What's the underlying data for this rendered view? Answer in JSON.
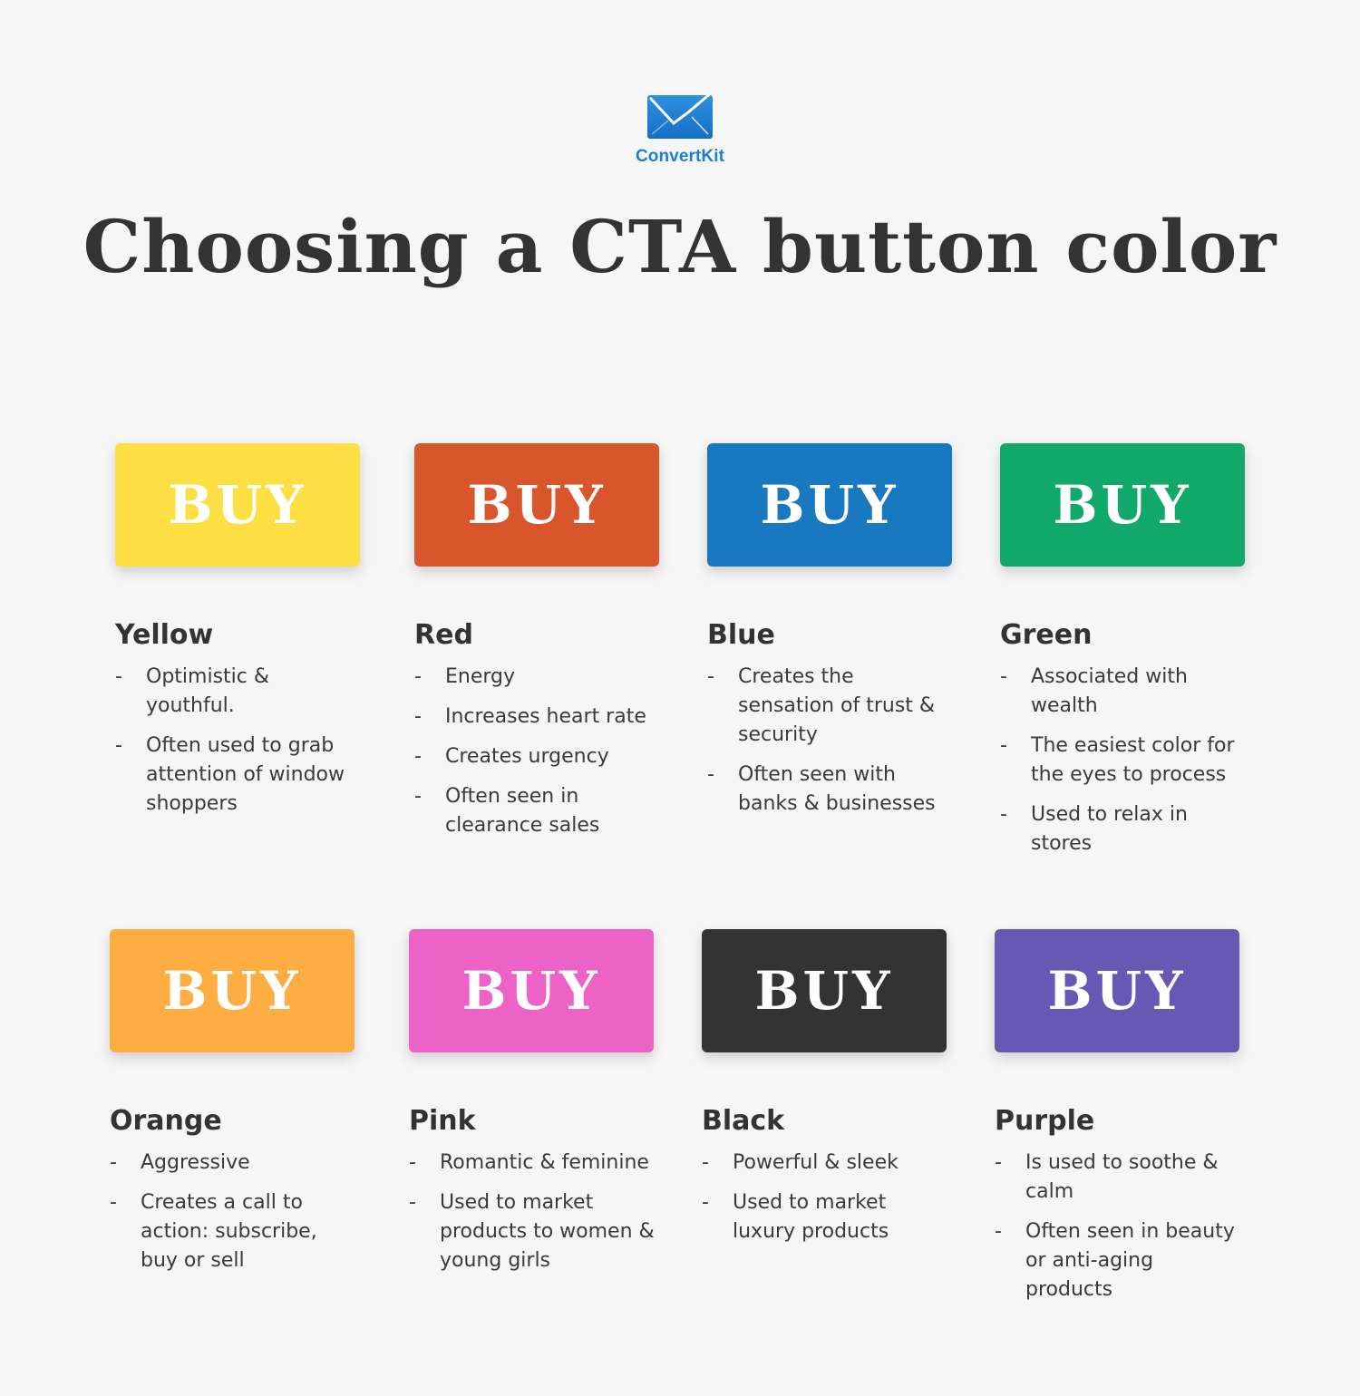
{
  "brand": {
    "name": "ConvertKit",
    "logo_icon": "envelope-icon",
    "brand_color": "#1d7fcf"
  },
  "title": "Choosing a CTA button color",
  "bullet_glyph": "-",
  "cards": [
    {
      "name": "Yellow",
      "button_label": "BUY",
      "button_color": "#fddf44",
      "traits": [
        "Optimistic & youthful.",
        "Often used to grab attention of window shoppers"
      ]
    },
    {
      "name": "Red",
      "button_label": "BUY",
      "button_color": "#d9562d",
      "traits": [
        "Energy",
        "Increases heart rate",
        "Creates urgency",
        "Often seen in clearance sales"
      ]
    },
    {
      "name": "Blue",
      "button_label": "BUY",
      "button_color": "#1878c0",
      "traits": [
        "Creates the sensation of trust & security",
        "Often seen with banks & businesses"
      ]
    },
    {
      "name": "Green",
      "button_label": "BUY",
      "button_color": "#11a96a",
      "traits": [
        "Associated with wealth",
        "The easiest color for the eyes to process",
        "Used to relax in stores"
      ]
    },
    {
      "name": "Orange",
      "button_label": "BUY",
      "button_color": "#fdad42",
      "traits": [
        "Aggressive",
        "Creates a call to action: subscribe, buy or sell"
      ]
    },
    {
      "name": "Pink",
      "button_label": "BUY",
      "button_color": "#ed62c6",
      "traits": [
        "Romantic & feminine",
        "Used to market products to women & young girls"
      ]
    },
    {
      "name": "Black",
      "button_label": "BUY",
      "button_color": "#333333",
      "traits": [
        "Powerful & sleek",
        "Used to market luxury products"
      ]
    },
    {
      "name": "Purple",
      "button_label": "BUY",
      "button_color": "#6759b3",
      "traits": [
        "Is used to soothe & calm",
        "Often seen in beauty or anti-aging products"
      ]
    }
  ]
}
